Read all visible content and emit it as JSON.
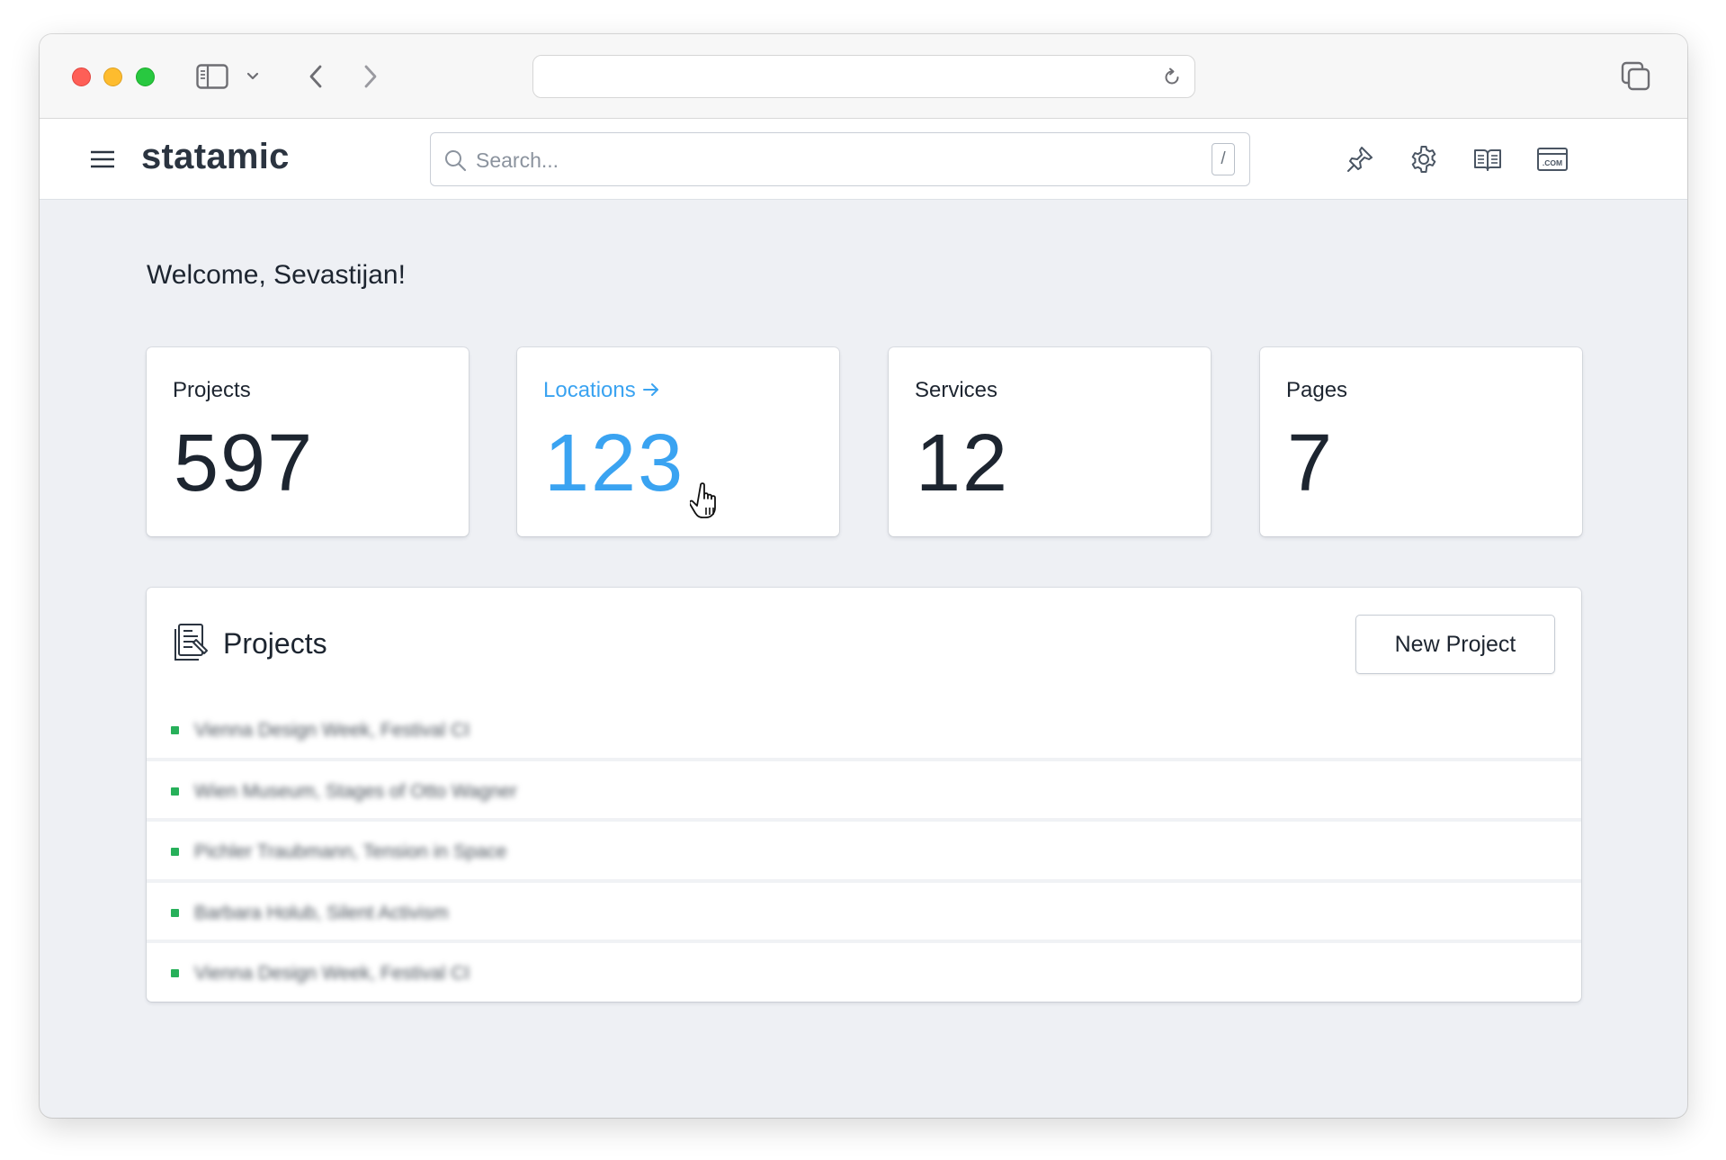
{
  "browser": {
    "url": "",
    "icons": [
      "sidebar-icon",
      "chevron-down-icon",
      "back-arrow-icon",
      "forward-arrow-icon",
      "reload-icon",
      "tabs-overview-icon"
    ]
  },
  "header": {
    "brand": "statamic",
    "search_placeholder": "Search...",
    "search_shortcut": "/",
    "icons": [
      "pin-icon",
      "gear-icon",
      "docs-book-icon",
      "site-domain-icon"
    ]
  },
  "main": {
    "welcome": "Welcome, Sevastijan!",
    "stats": [
      {
        "label": "Projects",
        "value": "597"
      },
      {
        "label": "Locations",
        "value": "123",
        "link": true
      },
      {
        "label": "Services",
        "value": "12"
      },
      {
        "label": "Pages",
        "value": "7"
      }
    ],
    "projects_panel": {
      "title": "Projects",
      "new_button": "New Project",
      "rows": [
        "Vienna Design Week, Festival CI",
        "Wien Museum, Stages of Otto Wagner",
        "Pichler Traubmann, Tension in Space",
        "Barbara Holub, Silent Activism",
        "Vienna Design Week, Festival CI"
      ],
      "status_color": "#27b05a"
    }
  },
  "colors": {
    "accent": "#3aa3f1",
    "text": "#1d2530",
    "background": "#eef0f4"
  }
}
